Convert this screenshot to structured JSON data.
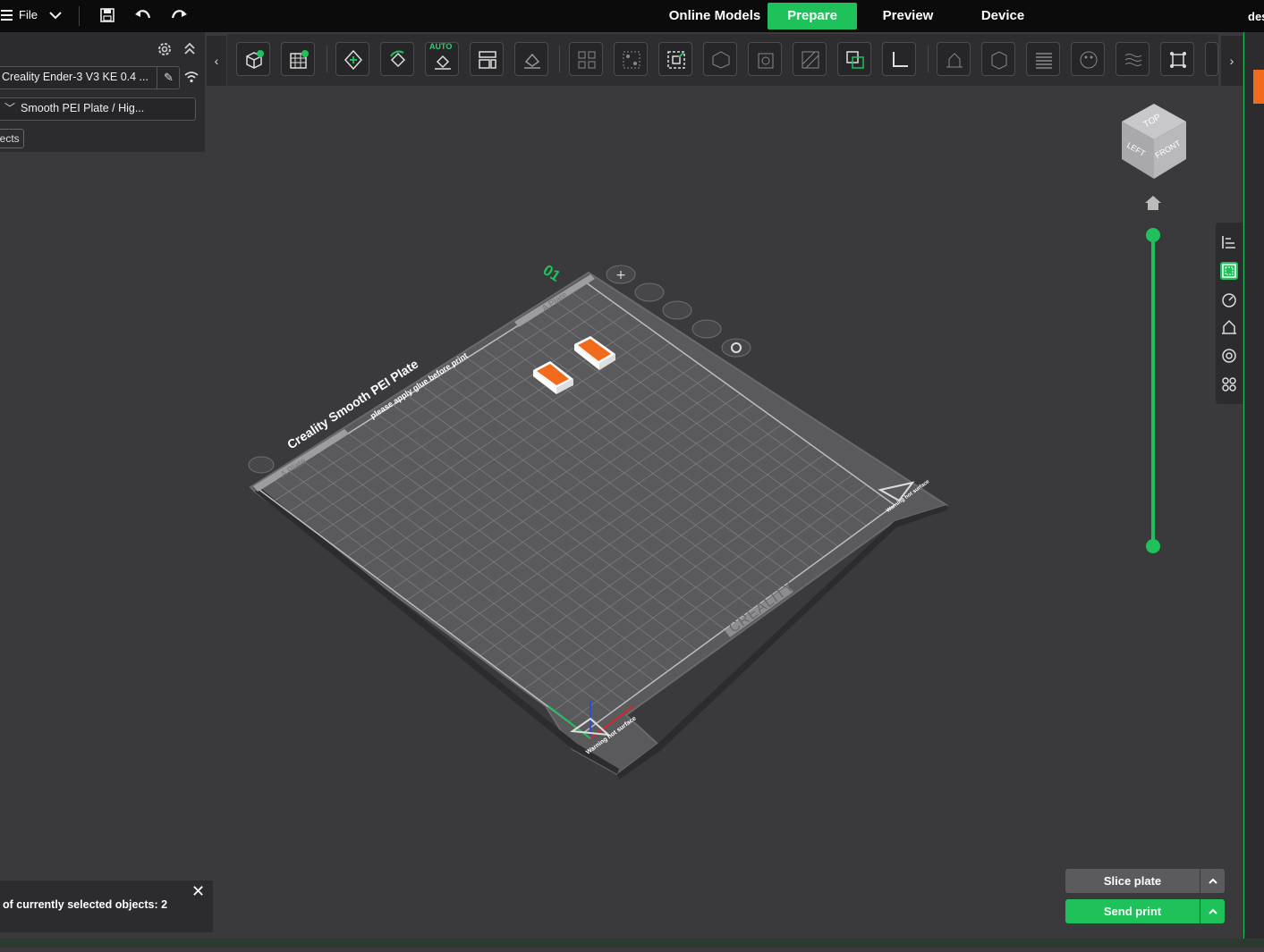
{
  "menu": {
    "file_label": "File"
  },
  "tabs": [
    {
      "label": "Online Models",
      "active": false
    },
    {
      "label": "Prepare",
      "active": true
    },
    {
      "label": "Preview",
      "active": false
    },
    {
      "label": "Device",
      "active": false
    }
  ],
  "user_fragment": "des",
  "left_panel": {
    "printer": "Creality Ender-3 V3 KE 0.4 ...",
    "plate": "Smooth PEI Plate / Hig...",
    "objects_tab": "jects"
  },
  "toolbar": {
    "auto_label": "AUTO"
  },
  "plate": {
    "number": "01",
    "name": "Creality Smooth PEI Plate",
    "glue_note": "please apply glue before print",
    "brand": "CREALITY",
    "side_label": "A Plate",
    "warning": "Warning hot surface"
  },
  "nav_cube": {
    "top": "TOP",
    "left": "LEFT",
    "front": "FRONT"
  },
  "notice": {
    "text": "of currently selected objects: 2"
  },
  "buttons": {
    "slice": "Slice plate",
    "send": "Send print"
  },
  "colors": {
    "accent": "#1fc15a",
    "model": "#f26b1d",
    "background": "#3a3a3d"
  },
  "icons": [
    "menu-icon",
    "chevron-down-icon",
    "save-icon",
    "undo-icon",
    "redo-icon",
    "settings-icon",
    "collapse-icon",
    "edit-icon",
    "wifi-icon",
    "add-object-icon",
    "add-plate-icon",
    "orient-icon",
    "auto-orient-icon",
    "arrange-icon",
    "lay-on-face-icon",
    "split-icon",
    "scale-icon",
    "home-icon"
  ]
}
